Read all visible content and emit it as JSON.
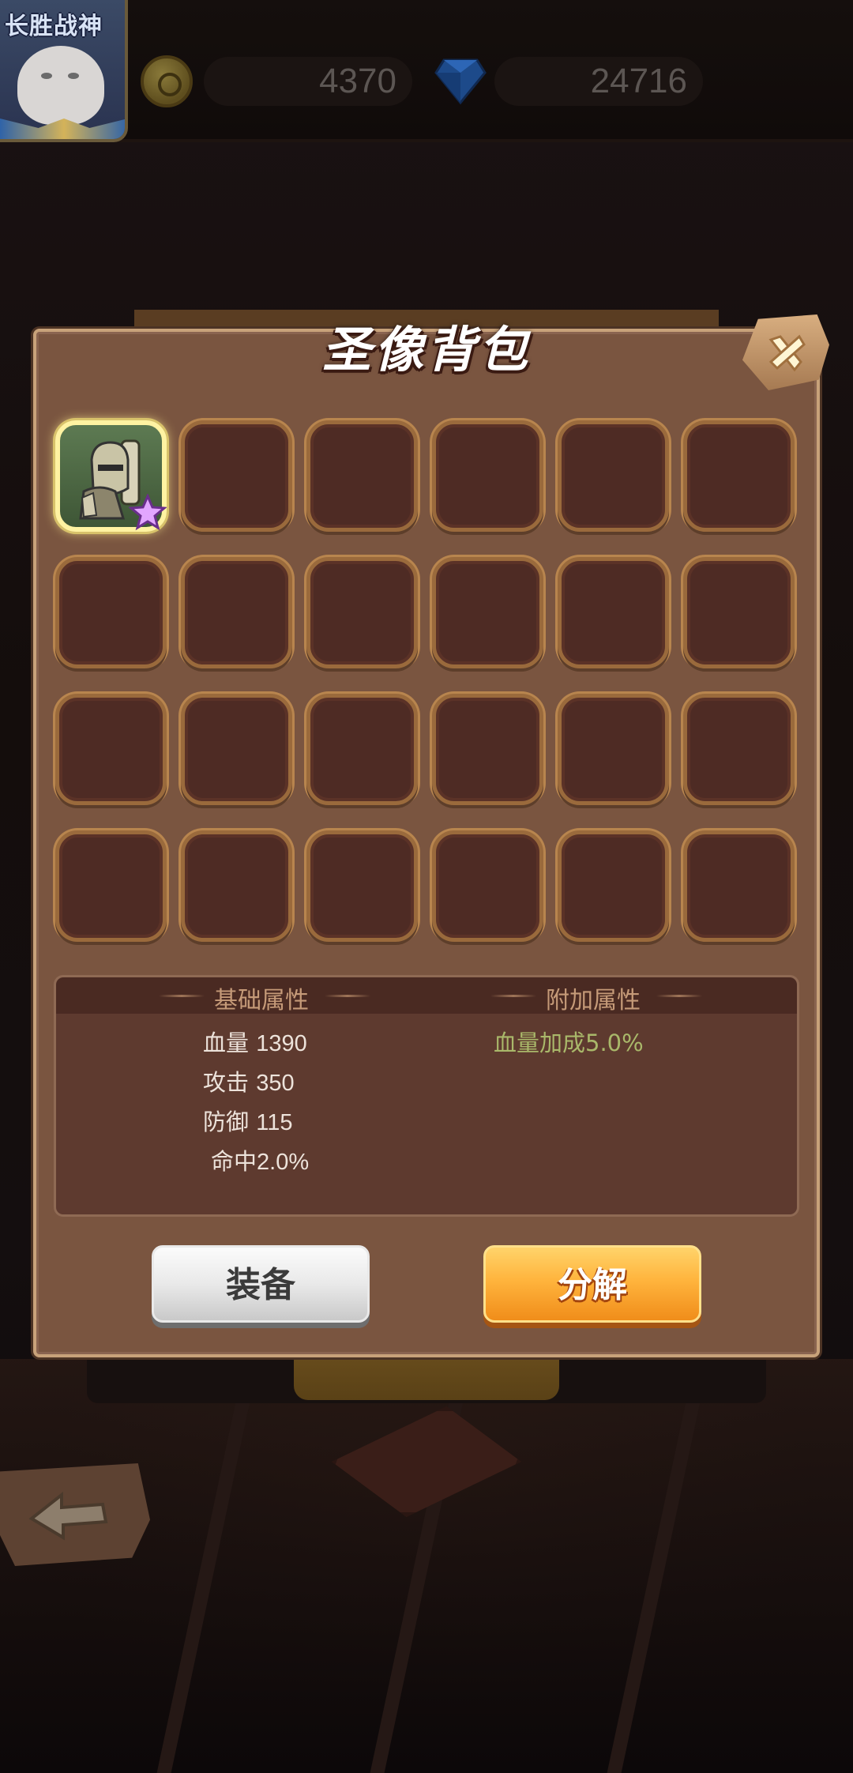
{
  "topbar": {
    "avatar_title": "长胜战神",
    "coins": "4370",
    "gems": "24716"
  },
  "dialog": {
    "title": "圣像背包",
    "slots_total": 24,
    "selected_slot": 1
  },
  "attributes": {
    "base_header": "基础属性",
    "extra_header": "附加属性",
    "base": [
      {
        "label": "血量",
        "value": "1390"
      },
      {
        "label": "攻击",
        "value": "350"
      },
      {
        "label": "防御",
        "value": "115"
      },
      {
        "label": "命中",
        "value": "2.0%"
      }
    ],
    "extra": [
      "血量加成5.0%"
    ]
  },
  "buttons": {
    "equip": "装备",
    "split": "分解"
  },
  "colors": {
    "panel": "#7a5540",
    "slot": "#4e2b24",
    "bonus_text": "#a9b86a",
    "split_button": "#ffb43d"
  }
}
